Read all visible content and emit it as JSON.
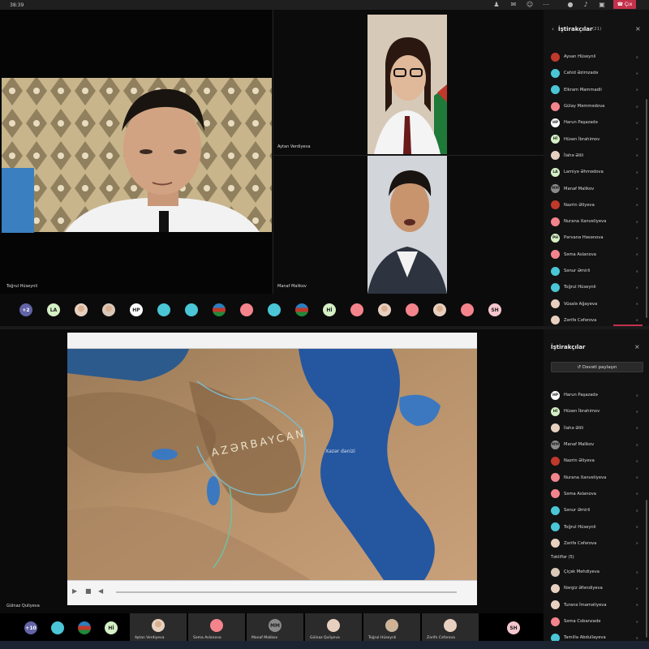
{
  "top_meeting": {
    "time": "38:39",
    "leave_label": "Çıx",
    "tiles": {
      "main_left_name": "Toğrul Hüseynli",
      "top_right_label": "Aytan Verdiyeva",
      "bottom_mid_label": "Manaf Malikov"
    },
    "avatar_strip": [
      {
        "initials": "+2",
        "color": "#6264a7"
      },
      {
        "initials": "LA",
        "color": "#d4f0c4"
      },
      {
        "initials": "",
        "color": "#e8d0c0",
        "photo": true
      },
      {
        "initials": "",
        "color": "#d9c8b8",
        "photo": true
      },
      {
        "initials": "HP",
        "color": "#ffffff"
      },
      {
        "initials": "",
        "color": "#4ac6d6"
      },
      {
        "initials": "",
        "color": "#4ac6d6"
      },
      {
        "initials": "",
        "color": "#c0392b",
        "flag": true
      },
      {
        "initials": "",
        "color": "#f4848c"
      },
      {
        "initials": "",
        "color": "#4ac6d6"
      },
      {
        "initials": "",
        "color": "#c0392b",
        "flag": true
      },
      {
        "initials": "Hİ",
        "color": "#d4f0c4"
      },
      {
        "initials": "",
        "color": "#f4848c"
      },
      {
        "initials": "",
        "color": "#e8d0c0",
        "photo": true
      },
      {
        "initials": "",
        "color": "#f4848c"
      },
      {
        "initials": "",
        "color": "#e8d0c0",
        "photo": true
      },
      {
        "initials": "",
        "color": "#f4848c"
      },
      {
        "initials": "SH",
        "color": "#f6c6ce"
      }
    ],
    "panel": {
      "title": "İştirakçılar",
      "count": "(21)",
      "participants": [
        {
          "name": "Aysan Hüseynli",
          "color": "#c0392b",
          "initials": ""
        },
        {
          "name": "Cahid Əzimzadə",
          "color": "#4ac6d6",
          "initials": ""
        },
        {
          "name": "Elkram Mammadli",
          "color": "#4ac6d6",
          "initials": ""
        },
        {
          "name": "Gülay Məmmədova",
          "color": "#f4848c",
          "initials": ""
        },
        {
          "name": "Harun Paşazadə",
          "color": "#ffffff",
          "initials": "HP"
        },
        {
          "name": "Hüsen İbrahimov",
          "color": "#d4f0c4",
          "initials": "Hİ"
        },
        {
          "name": "İlahə Əlili",
          "color": "#e8d0c0",
          "initials": ""
        },
        {
          "name": "Lamiyə Əhmədova",
          "color": "#d4f0c4",
          "initials": "LA"
        },
        {
          "name": "Manaf Malikov",
          "color": "#8a8a8a",
          "initials": "MM"
        },
        {
          "name": "Nazrin Əliyeva",
          "color": "#c0392b",
          "initials": ""
        },
        {
          "name": "Nurana Xanveliyeva",
          "color": "#f4848c",
          "initials": ""
        },
        {
          "name": "Pərvanə Həsənova",
          "color": "#d4f0c4",
          "initials": "PH"
        },
        {
          "name": "Səma Aslanova",
          "color": "#f4848c",
          "initials": ""
        },
        {
          "name": "Sənur Əmirli",
          "color": "#4ac6d6",
          "initials": ""
        },
        {
          "name": "Toğrul Hüseynli",
          "color": "#4ac6d6",
          "initials": ""
        },
        {
          "name": "Vüsalə Ağayeva",
          "color": "#e8d0c0",
          "initials": ""
        },
        {
          "name": "Zərifə Cəfərova",
          "color": "#e8d0c0",
          "initials": ""
        }
      ]
    }
  },
  "bottom_meeting": {
    "presenter_name": "Gülnaz Quliyeva",
    "map_label": "AZƏRBAYCAN",
    "sea_label": "Xəzər dənizi",
    "panel": {
      "title": "İştirakçılar",
      "share_label": "Dəvəti paylaşın",
      "participants": [
        {
          "name": "Harun Paşazadə",
          "color": "#ffffff",
          "initials": "HP"
        },
        {
          "name": "Hüsen İbrahimov",
          "color": "#d4f0c4",
          "initials": "Hİ"
        },
        {
          "name": "İlahə Əlili",
          "color": "#e8d0c0",
          "initials": ""
        },
        {
          "name": "Manaf Malikov",
          "color": "#8a8a8a",
          "initials": "MM"
        },
        {
          "name": "Nazrin Əliyeva",
          "color": "#c0392b",
          "initials": ""
        },
        {
          "name": "Nurana Xanveliyeva",
          "color": "#f4848c",
          "initials": ""
        },
        {
          "name": "Səma Aslanova",
          "color": "#f4848c",
          "initials": ""
        },
        {
          "name": "Sənur Əmirli",
          "color": "#4ac6d6",
          "initials": ""
        },
        {
          "name": "Toğrul Hüseynli",
          "color": "#4ac6d6",
          "initials": ""
        },
        {
          "name": "Zərifə Cəfərova",
          "color": "#e8d0c0",
          "initials": ""
        }
      ],
      "suggested_label": "Təkliflər (5)",
      "suggested": [
        {
          "name": "Çiçək Mehdiyeva",
          "color": "#d9c8b8",
          "initials": ""
        },
        {
          "name": "Nərgiz Əfəndiyeva",
          "color": "#e8d0c0",
          "initials": ""
        },
        {
          "name": "Turanə İmaməliyeva",
          "color": "#e8d0c0",
          "initials": ""
        },
        {
          "name": "Səma Cobanzadə",
          "color": "#f4848c",
          "initials": ""
        },
        {
          "name": "Tamilla Abdullayeva",
          "color": "#4ac6d6",
          "initials": ""
        }
      ]
    },
    "bottom_strip": {
      "small_avatars": [
        {
          "initials": "+10",
          "color": "#6264a7"
        },
        {
          "initials": "",
          "color": "#4ac6d6"
        },
        {
          "initials": "",
          "color": "#c0392b",
          "flag": true
        },
        {
          "initials": "Hİ",
          "color": "#d4f0c4"
        }
      ],
      "tiles": [
        {
          "name": "Aytan Verdiyeva",
          "initials": "",
          "color": "#e8d0c0",
          "photo": true
        },
        {
          "name": "Səma Aslanova",
          "initials": "",
          "color": "#f4848c"
        },
        {
          "name": "Manaf Malikov",
          "initials": "MM",
          "color": "#8a8a8a"
        },
        {
          "name": "Gülnaz Quliyeva",
          "initials": "",
          "color": "#e8d0c0"
        },
        {
          "name": "Toğrul Hüseynli",
          "initials": "",
          "color": "#c9b59a",
          "photo": true
        },
        {
          "name": "Zərifə Cəfərova",
          "initials": "",
          "color": "#e8d0c0"
        }
      ],
      "end_avatar": {
        "initials": "SH",
        "color": "#f6c6ce"
      }
    }
  }
}
